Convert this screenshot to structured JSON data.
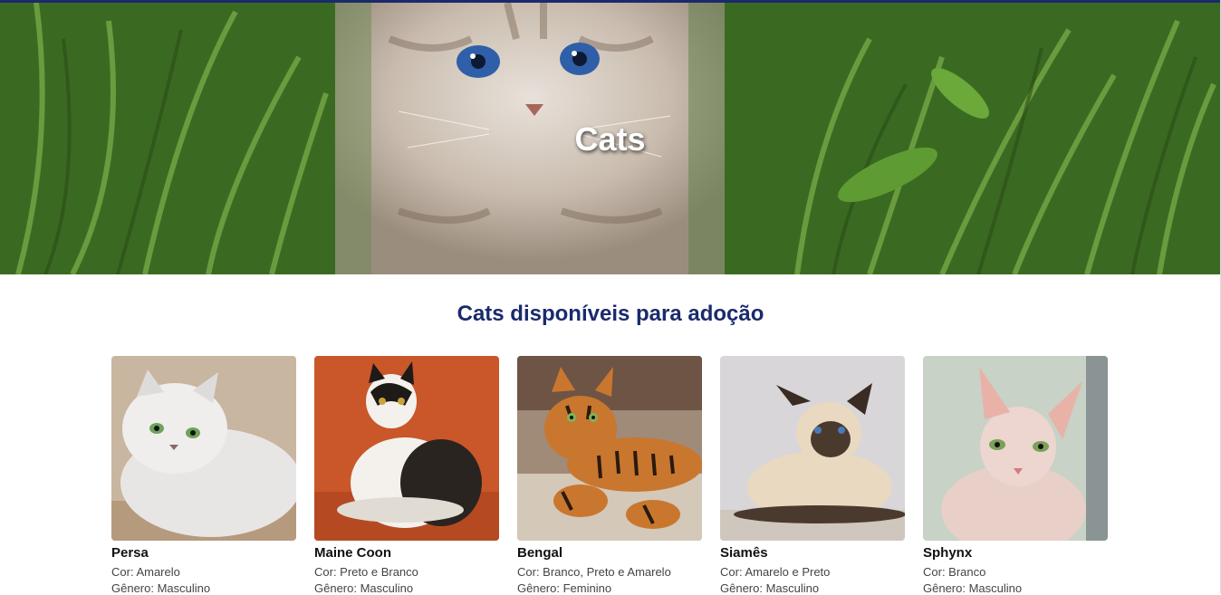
{
  "hero": {
    "title": "Cats"
  },
  "section": {
    "title": "Cats disponíveis para adoção"
  },
  "cats": [
    {
      "name": "Persa",
      "color": "Cor: Amarelo",
      "gender": "Gênero: Masculino",
      "palette": {
        "bg": "#c9b6a0",
        "body": "#e8e6e4",
        "eye": "#6fa25a"
      }
    },
    {
      "name": "Maine Coon",
      "color": "Cor: Preto e Branco",
      "gender": "Gênero: Masculino",
      "palette": {
        "bg": "#c9572a",
        "body": "#f4f1ec",
        "eye": "#c9a23a"
      }
    },
    {
      "name": "Bengal",
      "color": "Cor: Branco, Preto e Amarelo",
      "gender": "Gênero: Feminino",
      "palette": {
        "bg": "#a08a78",
        "body": "#c9772e",
        "eye": "#7fb35a"
      }
    },
    {
      "name": "Siamês",
      "color": "Cor: Amarelo e Preto",
      "gender": "Gênero: Masculino",
      "palette": {
        "bg": "#d8d6d9",
        "body": "#e9d9c0",
        "eye": "#4a7ab8"
      }
    },
    {
      "name": "Sphynx",
      "color": "Cor: Branco",
      "gender": "Gênero: Masculino",
      "palette": {
        "bg": "#c8d2c6",
        "body": "#e8cfc8",
        "eye": "#7ca05a"
      }
    }
  ]
}
